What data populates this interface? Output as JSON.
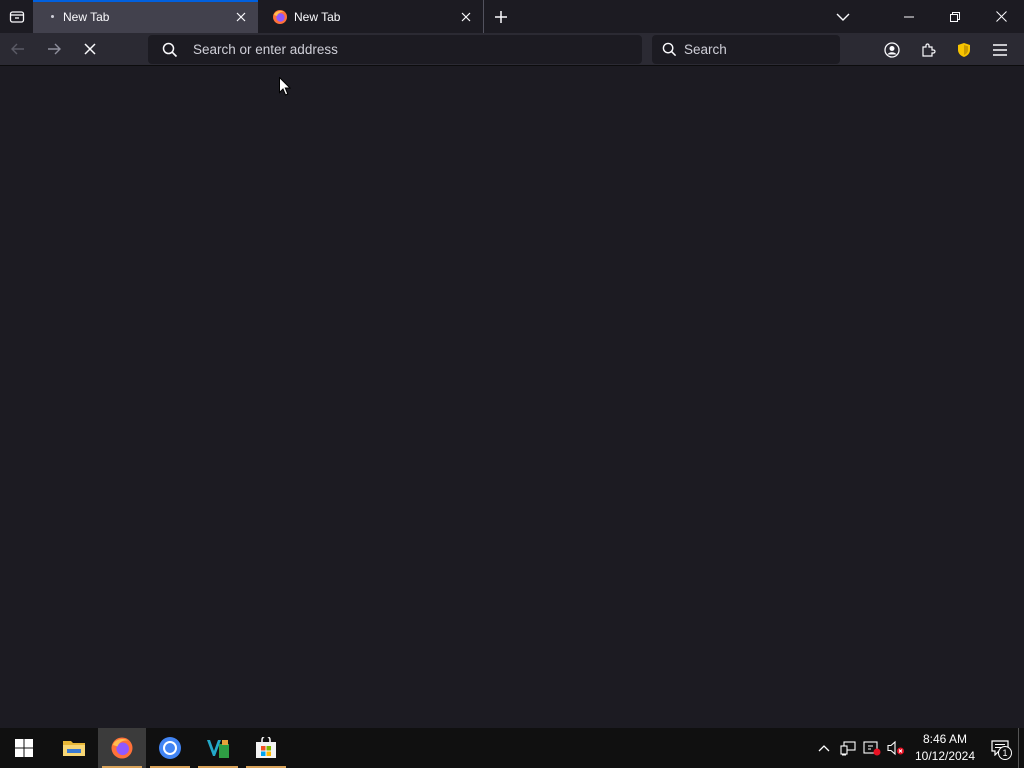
{
  "browser": {
    "tabs": [
      {
        "label": "New Tab",
        "active": true
      },
      {
        "label": "New Tab",
        "active": false
      }
    ],
    "urlbar": {
      "placeholder": "Search or enter address"
    },
    "searchbar": {
      "placeholder": "Search"
    }
  },
  "taskbar": {
    "apps": [
      "start-icon",
      "file-explorer-icon",
      "firefox-icon",
      "chrome-icon",
      "vscode-icon",
      "store-icon"
    ],
    "clock": {
      "time": "8:46 AM",
      "date": "10/12/2024"
    },
    "notification_count": "1"
  },
  "colors": {
    "background": "#1c1b22",
    "navbar": "#2b2a33",
    "active_tab": "#42414d",
    "accent": "#0060df",
    "taskbar": "#101010"
  }
}
